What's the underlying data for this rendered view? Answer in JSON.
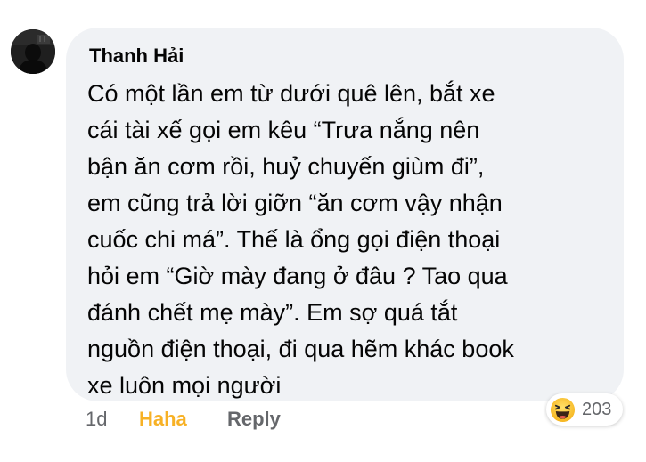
{
  "comment": {
    "author": "Thanh Hải",
    "lines": [
      "Có một lần em từ dưới quê lên, bắt xe",
      "cái tài xế gọi em kêu “Trưa nắng nên",
      "bận ăn cơm rồi, huỷ chuyến giùm đi”,",
      "em cũng trả lời giỡn “ăn cơm vậy nhận",
      "cuốc chi má”. Thế là ổng gọi điện thoại",
      "hỏi em “Giờ mày đang ở đâu ? Tao qua",
      "đánh chết mẹ mày”. Em sợ quá tắt",
      "nguồn điện thoại, đi qua hẽm khác book",
      "xe luôn mọi người"
    ]
  },
  "actions": {
    "time": "1d",
    "reaction_label": "Haha",
    "reply_label": "Reply"
  },
  "reactions": {
    "icon": "haha-emoji-icon",
    "count": "203"
  },
  "colors": {
    "bubble_bg": "#f0f2f5",
    "haha_color": "#f7b125",
    "muted_text": "#65676b",
    "text": "#050505"
  }
}
